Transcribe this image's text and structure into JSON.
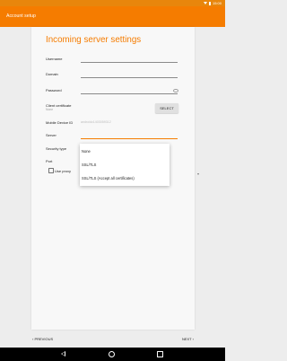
{
  "status_bar": {
    "time": "15:00"
  },
  "toolbar": {
    "title": "Account setup"
  },
  "form": {
    "heading": "Incoming server settings",
    "username_label": "Username",
    "domain_label": "Domain",
    "password_label": "Password",
    "client_cert_label": "Client certificate",
    "client_cert_value": "None",
    "select_button": "SELECT",
    "mobile_device_label": "Mobile Device ID",
    "mobile_device_value": "androidc1403059312",
    "server_label": "Server",
    "security_label": "Security type",
    "port_label": "Port",
    "proxy_label": "Use proxy"
  },
  "dropdown": {
    "options": [
      "None",
      "SSL/TLS",
      "SSL/TLS (Accept all certificates)"
    ]
  },
  "footer": {
    "prev": "PREVIOUS",
    "next": "NEXT"
  },
  "colors": {
    "accent": "#f57c00",
    "status_bar": "#e8860c"
  },
  "icons": [
    "wifi-icon",
    "battery-icon",
    "visibility-icon",
    "chevron-left-icon",
    "chevron-right-icon",
    "back-icon",
    "home-icon",
    "recents-icon"
  ]
}
